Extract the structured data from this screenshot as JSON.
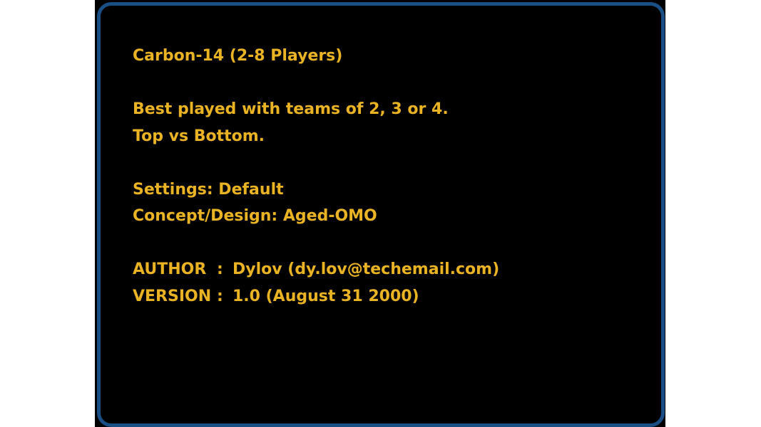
{
  "accent_color": "#e9b323",
  "border_color": "#1a4f86",
  "info": {
    "title": "Carbon-14 (2-8 Players)",
    "description_line1": "Best played with teams of 2, 3 or 4.",
    "description_line2": "Top vs Bottom.",
    "settings": "Settings: Default",
    "concept": "Concept/Design: Aged-OMO",
    "author_label": "AUTHOR",
    "author_value": "Dylov (dy.lov@techemail.com)",
    "version_label": "VERSION",
    "version_value": "1.0 (August 31 2000)",
    "separator": ":"
  }
}
